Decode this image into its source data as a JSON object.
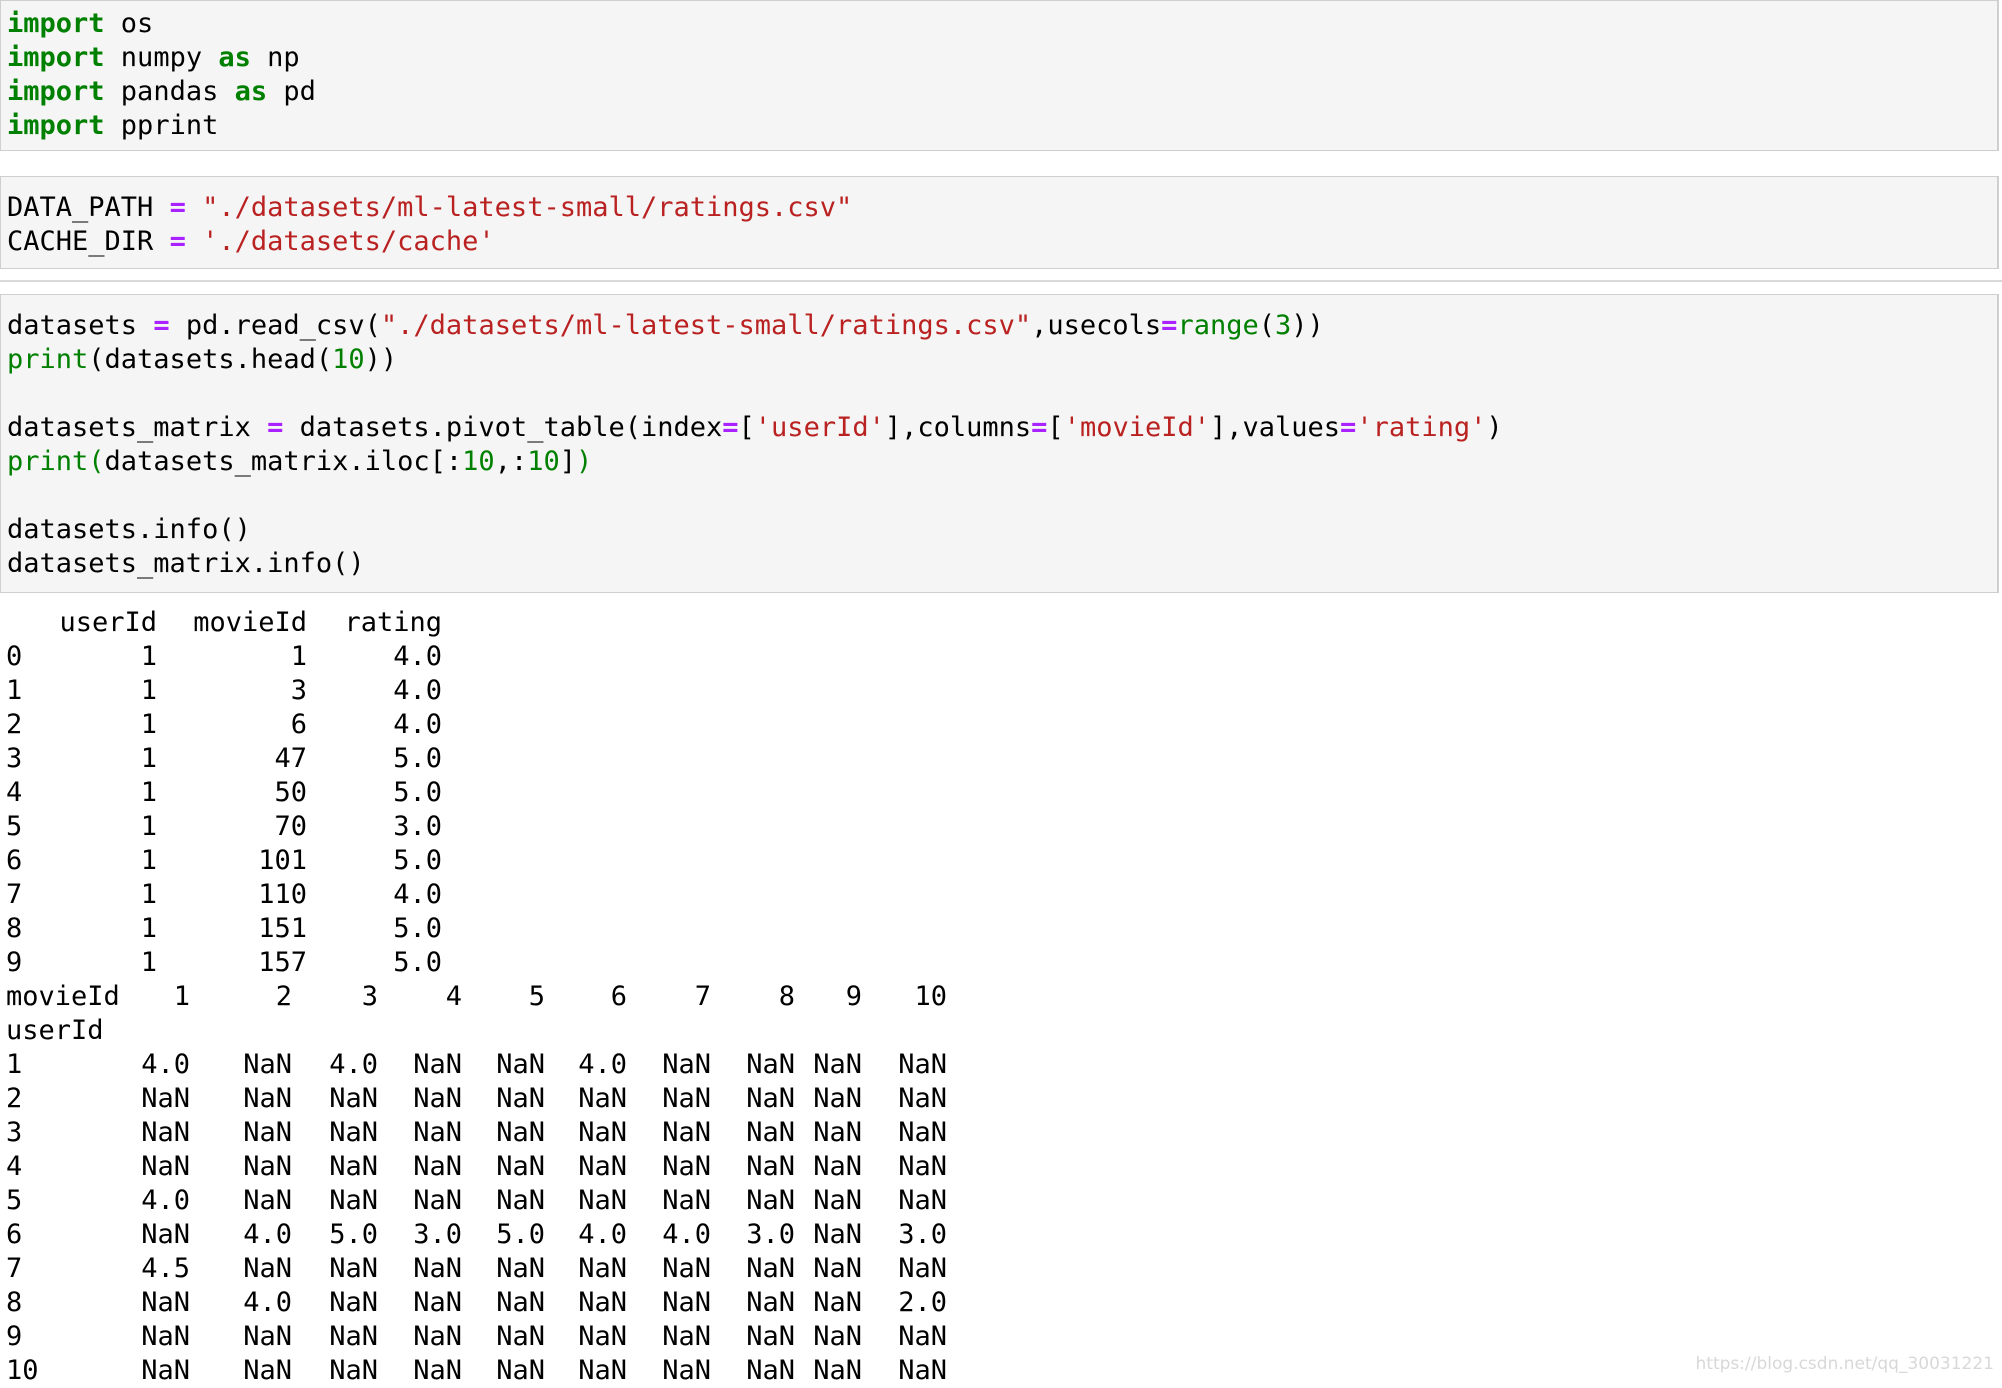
{
  "cells": {
    "cell1": {
      "line1": {
        "k": "import",
        "m": " os"
      },
      "line2": {
        "k1": "import",
        "m1": " numpy ",
        "k2": "as",
        "m2": " np"
      },
      "line3": {
        "k1": "import",
        "m1": " pandas ",
        "k2": "as",
        "m2": " pd"
      },
      "line4": {
        "k": "import",
        "m": " pprint"
      }
    },
    "cell2": {
      "line1": {
        "a": "DATA_PATH ",
        "op": "=",
        "s": " \"./datasets/ml-latest-small/ratings.csv\""
      },
      "line2": {
        "a": "CACHE_DIR ",
        "op": "=",
        "s": " './datasets/cache'"
      }
    },
    "cell3": {
      "l1": {
        "a": "datasets ",
        "op1": "=",
        "b": " pd.read_csv(",
        "s": "\"./datasets/ml-latest-small/ratings.csv\"",
        "c": ",usecols",
        "op2": "=",
        "bi": "range",
        "d": "(",
        "n": "3",
        "e": "))"
      },
      "l2": {
        "bi": "print",
        "a": "(datasets.head(",
        "n": "10",
        "b": "))"
      },
      "l3": {
        "a": "datasets_matrix ",
        "op1": "=",
        "b": " datasets.pivot_table(index",
        "op2": "=",
        "c": "[",
        "s1": "'userId'",
        "d": "],columns",
        "op3": "=",
        "e": "[",
        "s2": "'movieId'",
        "f": "],values",
        "op4": "=",
        "s3": "'rating'",
        "g": ")"
      },
      "l4": {
        "bi": "print(",
        "a": "datasets_matrix.iloc[:",
        "n1": "10",
        "b": ",:",
        "n2": "10",
        "c": "]",
        "bi2": ")"
      },
      "l5": {
        "a": "datasets.info()"
      },
      "l6": {
        "a": "datasets_matrix.info()"
      }
    }
  },
  "output": {
    "head_table": {
      "columns": [
        "userId",
        "movieId",
        "rating"
      ],
      "rows": [
        [
          "0",
          "1",
          "1",
          "4.0"
        ],
        [
          "1",
          "1",
          "3",
          "4.0"
        ],
        [
          "2",
          "1",
          "6",
          "4.0"
        ],
        [
          "3",
          "1",
          "47",
          "5.0"
        ],
        [
          "4",
          "1",
          "50",
          "5.0"
        ],
        [
          "5",
          "1",
          "70",
          "3.0"
        ],
        [
          "6",
          "1",
          "101",
          "5.0"
        ],
        [
          "7",
          "1",
          "110",
          "4.0"
        ],
        [
          "8",
          "1",
          "151",
          "5.0"
        ],
        [
          "9",
          "1",
          "157",
          "5.0"
        ]
      ]
    },
    "matrix_table": {
      "col_label": "movieId",
      "row_label": "userId",
      "columns": [
        "1",
        "2",
        "3",
        "4",
        "5",
        "6",
        "7",
        "8",
        "9",
        "10"
      ],
      "rows": [
        [
          "1",
          "4.0",
          "NaN",
          "4.0",
          "NaN",
          "NaN",
          "4.0",
          "NaN",
          "NaN",
          "NaN",
          "NaN"
        ],
        [
          "2",
          "NaN",
          "NaN",
          "NaN",
          "NaN",
          "NaN",
          "NaN",
          "NaN",
          "NaN",
          "NaN",
          "NaN"
        ],
        [
          "3",
          "NaN",
          "NaN",
          "NaN",
          "NaN",
          "NaN",
          "NaN",
          "NaN",
          "NaN",
          "NaN",
          "NaN"
        ],
        [
          "4",
          "NaN",
          "NaN",
          "NaN",
          "NaN",
          "NaN",
          "NaN",
          "NaN",
          "NaN",
          "NaN",
          "NaN"
        ],
        [
          "5",
          "4.0",
          "NaN",
          "NaN",
          "NaN",
          "NaN",
          "NaN",
          "NaN",
          "NaN",
          "NaN",
          "NaN"
        ],
        [
          "6",
          "NaN",
          "4.0",
          "5.0",
          "3.0",
          "5.0",
          "4.0",
          "4.0",
          "3.0",
          "NaN",
          "3.0"
        ],
        [
          "7",
          "4.5",
          "NaN",
          "NaN",
          "NaN",
          "NaN",
          "NaN",
          "NaN",
          "NaN",
          "NaN",
          "NaN"
        ],
        [
          "8",
          "NaN",
          "4.0",
          "NaN",
          "NaN",
          "NaN",
          "NaN",
          "NaN",
          "NaN",
          "NaN",
          "2.0"
        ],
        [
          "9",
          "NaN",
          "NaN",
          "NaN",
          "NaN",
          "NaN",
          "NaN",
          "NaN",
          "NaN",
          "NaN",
          "NaN"
        ],
        [
          "10",
          "NaN",
          "NaN",
          "NaN",
          "NaN",
          "NaN",
          "NaN",
          "NaN",
          "NaN",
          "NaN",
          "NaN"
        ]
      ]
    }
  },
  "watermark": "https://blog.csdn.net/qq_30031221"
}
